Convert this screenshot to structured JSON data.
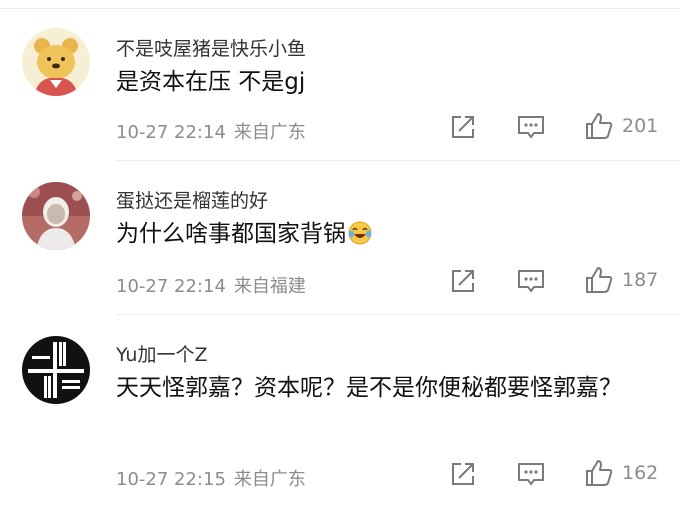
{
  "comments": [
    {
      "username": "不是吱屋猪是快乐小鱼",
      "content": "是资本在压 不是gj",
      "time": "10-27 22:14",
      "location": "来自广东",
      "likes": "201",
      "avatar_icon": "winnie-the-pooh-avatar"
    },
    {
      "username": "蛋挞还是榴莲的好",
      "content": "为什么啥事都国家背锅",
      "emoji_icon": "laughing-crying-emoji",
      "time": "10-27 22:14",
      "location": "来自福建",
      "likes": "187",
      "avatar_icon": "person-photo-avatar"
    },
    {
      "username": "Yu加一个Z",
      "content": "天天怪郭嘉？资本呢？是不是你便秘都要怪郭嘉？",
      "time": "10-27 22:15",
      "location": "来自广东",
      "likes": "162",
      "avatar_icon": "black-logo-avatar"
    }
  ],
  "colors": {
    "meta_text": "#8c8c8c",
    "icon_stroke": "#7a7a7a",
    "content_text": "#111111",
    "username_text": "#333333"
  }
}
